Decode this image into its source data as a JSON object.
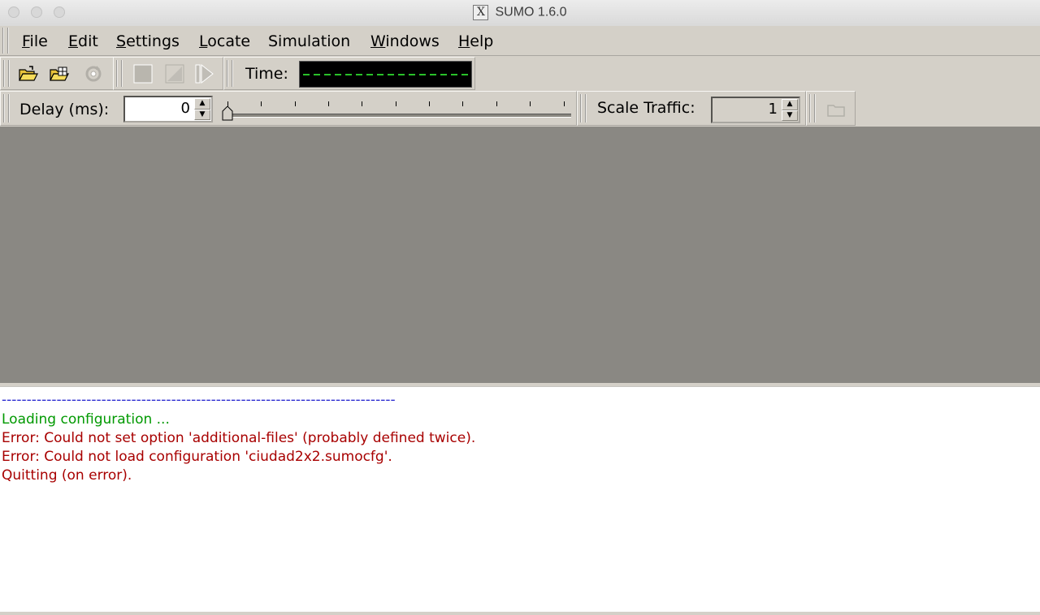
{
  "window": {
    "title": "SUMO 1.6.0",
    "logo_letter": "X"
  },
  "menu": [
    {
      "accel": "F",
      "rest": "ile"
    },
    {
      "accel": "E",
      "rest": "dit"
    },
    {
      "accel": "S",
      "rest": "ettings"
    },
    {
      "accel": "L",
      "rest": "ocate"
    },
    {
      "pre": "Simulation"
    },
    {
      "accel": "W",
      "rest": "indows"
    },
    {
      "accel": "H",
      "rest": "elp"
    }
  ],
  "toolbar": {
    "time_label": "Time:",
    "delay_label": "Delay (ms):",
    "delay_value": "0",
    "delay_fraction": 0,
    "scale_label": "Scale Traffic:",
    "scale_value": "1"
  },
  "icons": [
    "open-config-icon",
    "open-network-icon",
    "reload-icon",
    "stop-icon",
    "step-icon",
    "run-icon",
    "folder-icon"
  ],
  "log": {
    "separator": "-------------------------------------------------------------------------------",
    "lines": [
      {
        "text": "Loading configuration ...",
        "color": "#009900"
      },
      {
        "text": "Error: Could not set option 'additional-files' (probably defined twice).",
        "color": "#a80000"
      },
      {
        "text": "Error: Could not load configuration 'ciudad2x2.sumocfg'.",
        "color": "#a80000"
      },
      {
        "text": "Quitting (on error).",
        "color": "#a80000"
      }
    ],
    "separator_color": "#2a2ad0"
  }
}
